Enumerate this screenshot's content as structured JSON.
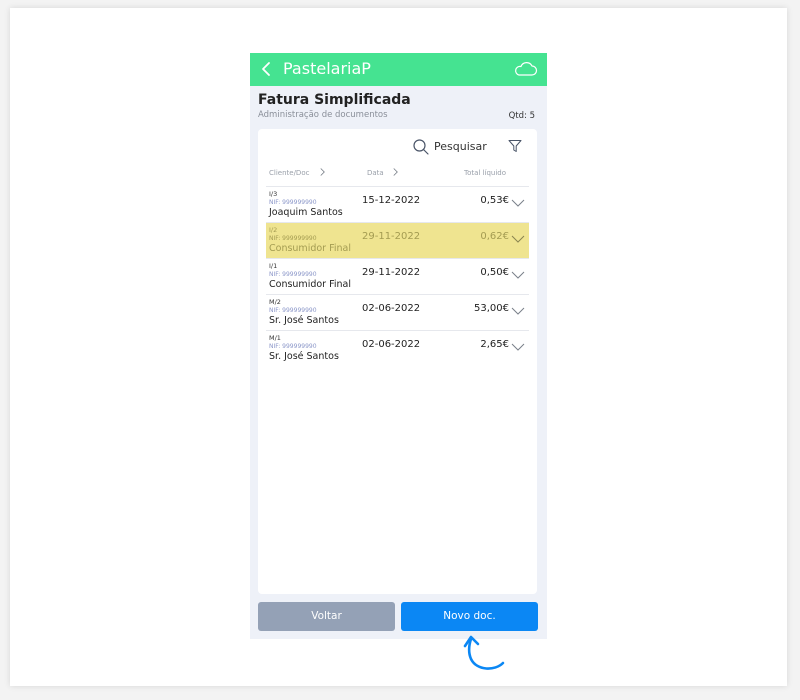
{
  "header": {
    "app_title": "PastelariaP",
    "back_icon": "chevron-left-icon",
    "cloud_icon": "cloud-icon",
    "bar_color": "#45e391"
  },
  "page": {
    "title": "Fatura Simplificada",
    "subtitle": "Administração de documentos",
    "qty": "Qtd: 5"
  },
  "search": {
    "label": "Pesquisar"
  },
  "columns": [
    "Cliente/Doc",
    "Data",
    "Total líquido"
  ],
  "rows": [
    {
      "doc": "I/3",
      "nif": "NIF: 999999990",
      "client": "Joaquim Santos",
      "date": "15-12-2022",
      "total": "0,53€",
      "highlighted": false
    },
    {
      "doc": "I/2",
      "nif": "NIF: 999999990",
      "client": "Consumidor Final",
      "date": "29-11-2022",
      "total": "0,62€",
      "highlighted": true
    },
    {
      "doc": "I/1",
      "nif": "NIF: 999999990",
      "client": "Consumidor Final",
      "date": "29-11-2022",
      "total": "0,50€",
      "highlighted": false
    },
    {
      "doc": "M/2",
      "nif": "NIF: 999999990",
      "client": "Sr. José Santos",
      "date": "02-06-2022",
      "total": "53,00€",
      "highlighted": false
    },
    {
      "doc": "M/1",
      "nif": "NIF: 999999990",
      "client": "Sr. José Santos",
      "date": "02-06-2022",
      "total": "2,65€",
      "highlighted": false
    }
  ],
  "buttons": {
    "back": "Voltar",
    "new_doc": "Novo doc."
  },
  "colors": {
    "accent": "#0b87f4",
    "highlight": "#efe490",
    "secondary": "#94a1b6"
  }
}
